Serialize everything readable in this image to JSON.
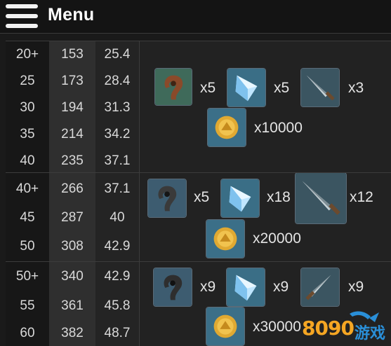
{
  "header": {
    "menu_label": "Menu"
  },
  "rows": [
    {
      "level": "20+",
      "c2": "153",
      "c3": "25.4"
    },
    {
      "level": "25",
      "c2": "173",
      "c3": "28.4"
    },
    {
      "level": "30",
      "c2": "194",
      "c3": "31.3"
    },
    {
      "level": "35",
      "c2": "214",
      "c3": "34.2"
    },
    {
      "level": "40",
      "c2": "235",
      "c3": "37.1"
    },
    {
      "level": "40+",
      "c2": "266",
      "c3": "37.1"
    },
    {
      "level": "45",
      "c2": "287",
      "c3": "40"
    },
    {
      "level": "50",
      "c2": "308",
      "c3": "42.9"
    },
    {
      "level": "50+",
      "c2": "340",
      "c3": "42.9"
    },
    {
      "level": "55",
      "c2": "361",
      "c3": "45.8"
    },
    {
      "level": "60",
      "c2": "382",
      "c3": "48.7"
    }
  ],
  "materials": [
    {
      "shell": "x5",
      "crystal": "x5",
      "blade": "x3",
      "coin": "x10000"
    },
    {
      "shell": "x5",
      "crystal": "x18",
      "blade": "x12",
      "coin": "x20000"
    },
    {
      "shell": "x9",
      "crystal": "x9",
      "blade": "x9",
      "coin": "x30000"
    }
  ],
  "icons": {
    "shell": "shell-material-icon",
    "crystal": "crystal-shard-icon",
    "blade": "dagger-blade-icon",
    "coin": "gold-coin-icon"
  },
  "watermark": {
    "number": "8090",
    "text": "游戏"
  },
  "colors": {
    "background": "#1a1a1a",
    "coin": "#e0a932",
    "crystal": "#9fd3f5",
    "watermark_orange": "#f5a623",
    "watermark_blue": "#2a8fd8"
  }
}
